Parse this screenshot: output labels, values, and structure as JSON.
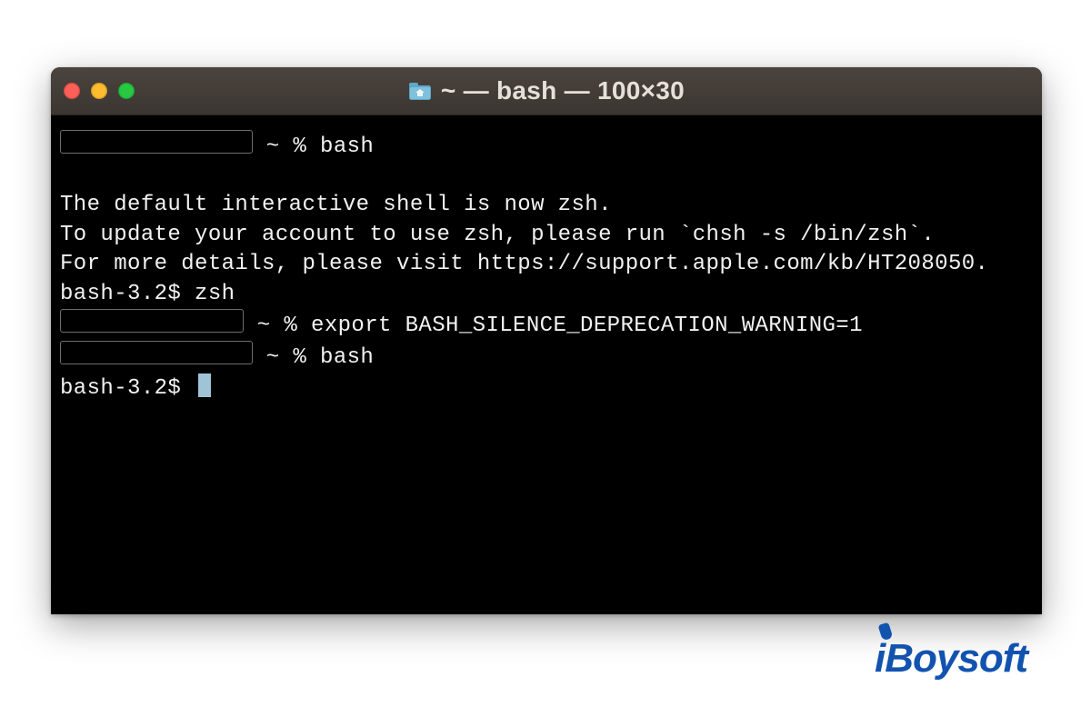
{
  "window": {
    "title": "~ — bash — 100×30",
    "home_icon": "home-folder-icon"
  },
  "terminal": {
    "prompt_zsh_suffix": " ~ % ",
    "prompt_bash": "bash-3.2$ ",
    "cmd_bash": "bash",
    "cmd_zsh": "zsh",
    "cmd_export": "export BASH_SILENCE_DEPRECATION_WARNING=1",
    "msg1": "The default interactive shell is now zsh.",
    "msg2": "To update your account to use zsh, please run `chsh -s /bin/zsh`.",
    "msg3": "For more details, please visit https://support.apple.com/kb/HT208050."
  },
  "watermark": {
    "text": "iBoysoft"
  }
}
